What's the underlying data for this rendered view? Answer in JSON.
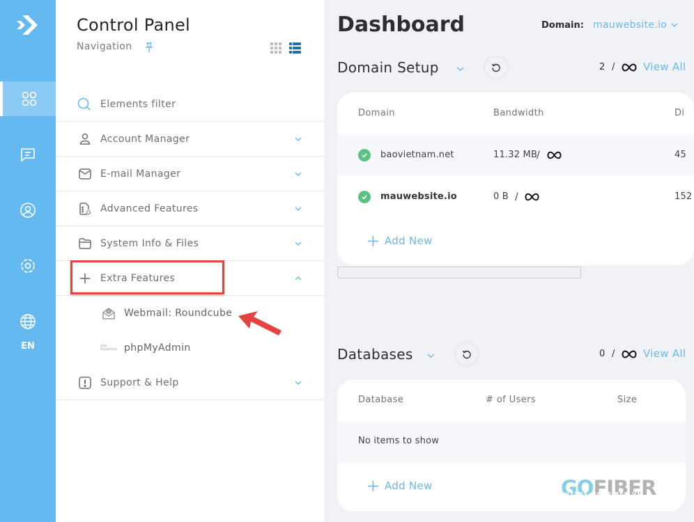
{
  "rail": {
    "items": [
      {
        "name": "dashboard",
        "icon": "grid-icon",
        "active": true
      },
      {
        "name": "messages",
        "icon": "message-icon",
        "active": false
      },
      {
        "name": "account",
        "icon": "user-circle-icon",
        "active": false
      },
      {
        "name": "settings",
        "icon": "gear-icon",
        "active": false
      },
      {
        "name": "language",
        "icon": "globe-icon",
        "active": false
      }
    ],
    "language_label": "EN"
  },
  "nav": {
    "title": "Control Panel",
    "subtitle": "Navigation",
    "filter_placeholder": "Elements filter",
    "menu": [
      {
        "label": "Account Manager",
        "icon": "user-icon",
        "expanded": false
      },
      {
        "label": "E-mail Manager",
        "icon": "mail-icon",
        "expanded": false
      },
      {
        "label": "Advanced Features",
        "icon": "advanced-doc-icon",
        "expanded": false
      },
      {
        "label": "System Info & Files",
        "icon": "folder-icon",
        "expanded": false
      },
      {
        "label": "Extra Features",
        "icon": "plus-icon",
        "expanded": true,
        "children": [
          {
            "label": "Webmail: Roundcube",
            "icon": "roundcube-icon"
          },
          {
            "label": "phpMyAdmin",
            "icon": "phpmyadmin-icon"
          }
        ]
      },
      {
        "label": "Support & Help",
        "icon": "alert-icon",
        "expanded": false
      }
    ],
    "phpmyadmin_logo_text": [
      "php",
      "MyAdmin"
    ]
  },
  "main": {
    "title": "Dashboard",
    "domain_label": "Domain:",
    "domain_value": "mauwebsite.io",
    "domain_setup": {
      "title": "Domain Setup",
      "count": "2",
      "separator": "/",
      "limit": "∞",
      "view_all": "View All",
      "columns": [
        "Domain",
        "Bandwidth",
        "Di"
      ],
      "rows": [
        {
          "domain": "baovietnam.net",
          "bandwidth": "11.32 MB",
          "limit": "∞",
          "disk": "45",
          "status": "active"
        },
        {
          "domain": "mauwebsite.io",
          "bandwidth": "0 B",
          "limit": "∞",
          "disk": "152",
          "status": "active"
        }
      ],
      "add_new": "Add New"
    },
    "databases": {
      "title": "Databases",
      "count": "0",
      "separator": "/",
      "limit": "∞",
      "view_all": "View All",
      "columns": [
        "Database",
        "# of Users",
        "Size"
      ],
      "empty_text": "No items to show",
      "add_new": "Add New"
    }
  },
  "colors": {
    "rail": "#63b9f0",
    "accent": "#6bb8ec",
    "success": "#5cc281",
    "highlight": "#e5433f"
  },
  "watermark": {
    "part_a": "GO",
    "part_b": "FIBER",
    "url": "HTTPS://GOFIBER.VN"
  }
}
